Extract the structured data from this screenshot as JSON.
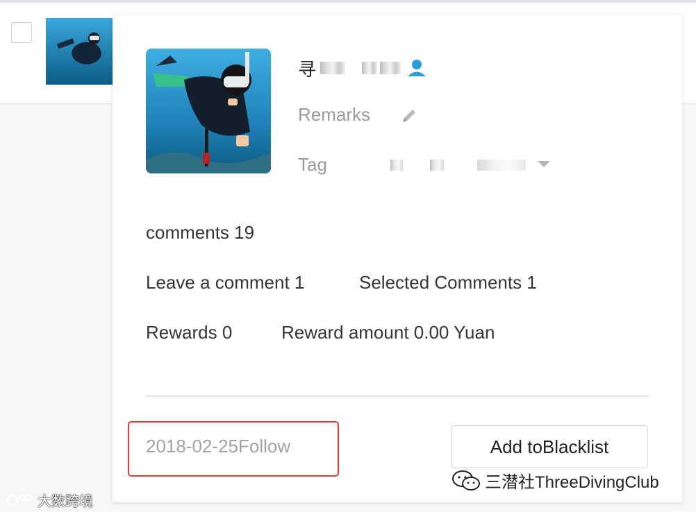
{
  "profile": {
    "nickname_visible": "寻",
    "remarks_label": "Remarks",
    "tag_label": "Tag"
  },
  "stats": {
    "comments": "comments 19",
    "leave_comment": "Leave a comment 1",
    "selected_comments": "Selected Comments 1",
    "rewards": "Rewards 0",
    "reward_amount": "Reward amount 0.00 Yuan"
  },
  "footer": {
    "follow_date": "2018-02-25Follow",
    "blacklist_button": "Add toBlacklist"
  },
  "watermarks": {
    "left": "大数跨境",
    "right": "三潜社ThreeDivingClub"
  },
  "icons": [
    "checkbox",
    "person-icon",
    "pencil-icon",
    "caret-down-icon",
    "wechat-icon"
  ],
  "colors": {
    "highlight_border": "#e53935",
    "person_icon": "#2a9fd6",
    "muted_text": "#9b9b9b"
  }
}
